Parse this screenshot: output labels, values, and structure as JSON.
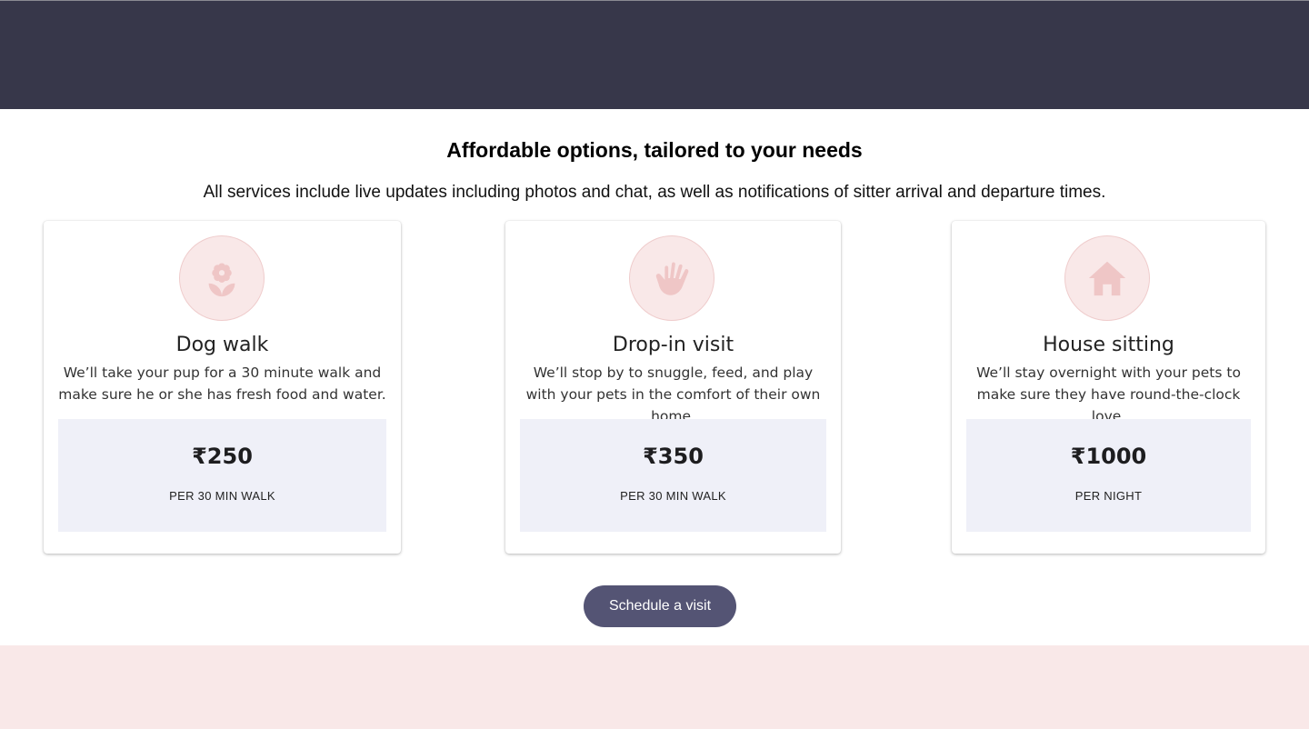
{
  "section": {
    "heading": "Affordable options, tailored to your needs",
    "subheading": "All services include live updates including photos and chat, as well as notifications of sitter arrival and departure times."
  },
  "cards": [
    {
      "icon": "flower-icon",
      "title": "Dog walk",
      "description": "We’ll take your pup for a 30 minute walk and make sure he or she has fresh food and water.",
      "price": "₹250",
      "unit": "PER 30 MIN WALK"
    },
    {
      "icon": "hand-icon",
      "title": "Drop-in visit",
      "description": "We’ll stop by to snuggle, feed, and play with your pets in the comfort of their own home.",
      "price": "₹350",
      "unit": "PER 30 MIN WALK"
    },
    {
      "icon": "house-icon",
      "title": "House sitting",
      "description": "We’ll stay overnight with your pets to make sure they have round-the-clock love.",
      "price": "₹1000",
      "unit": "PER NIGHT"
    }
  ],
  "cta": {
    "label": "Schedule a visit"
  },
  "colors": {
    "header_band": "#37374a",
    "icon_circle": "#f9e8e8",
    "icon_glyph": "#efc6c6",
    "price_box": "#eff0f8",
    "cta_button": "#545474",
    "footer_band": "#f9e8e8"
  }
}
